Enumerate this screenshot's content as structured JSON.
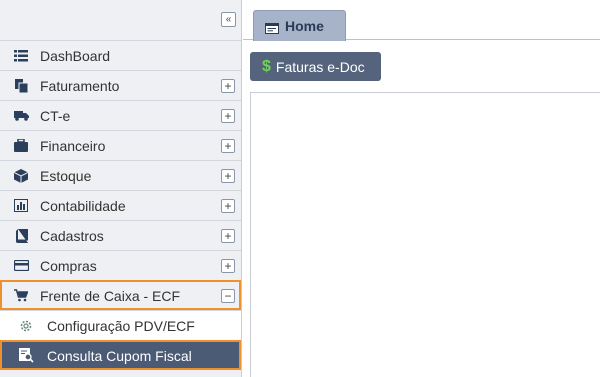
{
  "sidebar": {
    "collapse_icon": "double-chevron-left-icon",
    "collapse_glyph": "«",
    "items": [
      {
        "label": "DashBoard",
        "icon": "list-icon",
        "expandable": false
      },
      {
        "label": "Faturamento",
        "icon": "documents-icon",
        "expandable": true,
        "toggle": "+"
      },
      {
        "label": "CT-e",
        "icon": "truck-icon",
        "expandable": true,
        "toggle": "+"
      },
      {
        "label": "Financeiro",
        "icon": "briefcase-icon",
        "expandable": true,
        "toggle": "+"
      },
      {
        "label": "Estoque",
        "icon": "cube-icon",
        "expandable": true,
        "toggle": "+"
      },
      {
        "label": "Contabilidade",
        "icon": "bar-chart-icon",
        "expandable": true,
        "toggle": "+"
      },
      {
        "label": "Cadastros",
        "icon": "book-icon",
        "expandable": true,
        "toggle": "+"
      },
      {
        "label": "Compras",
        "icon": "credit-card-icon",
        "expandable": true,
        "toggle": "+"
      },
      {
        "label": "Frente de Caixa - ECF",
        "icon": "shopping-cart-icon",
        "expandable": true,
        "toggle": "−",
        "expanded": true
      }
    ],
    "subitems": [
      {
        "label": "Configuração PDV/ECF",
        "icon": "gear-icon",
        "selected": false
      },
      {
        "label": "Consulta Cupom Fiscal",
        "icon": "receipt-search-icon",
        "selected": true
      }
    ]
  },
  "tabs": [
    {
      "label": "Home",
      "icon": "window-icon",
      "active": true
    }
  ],
  "toolbar": {
    "faturas_label": "Faturas e-Doc",
    "faturas_icon": "dollar-icon",
    "dollar_glyph": "$"
  },
  "colors": {
    "accent_highlight": "#f0902c",
    "selected_bg": "#4b5a75",
    "tab_bg": "#a6b3c9",
    "button_bg": "#55637c",
    "dollar_green": "#6fd15a"
  }
}
